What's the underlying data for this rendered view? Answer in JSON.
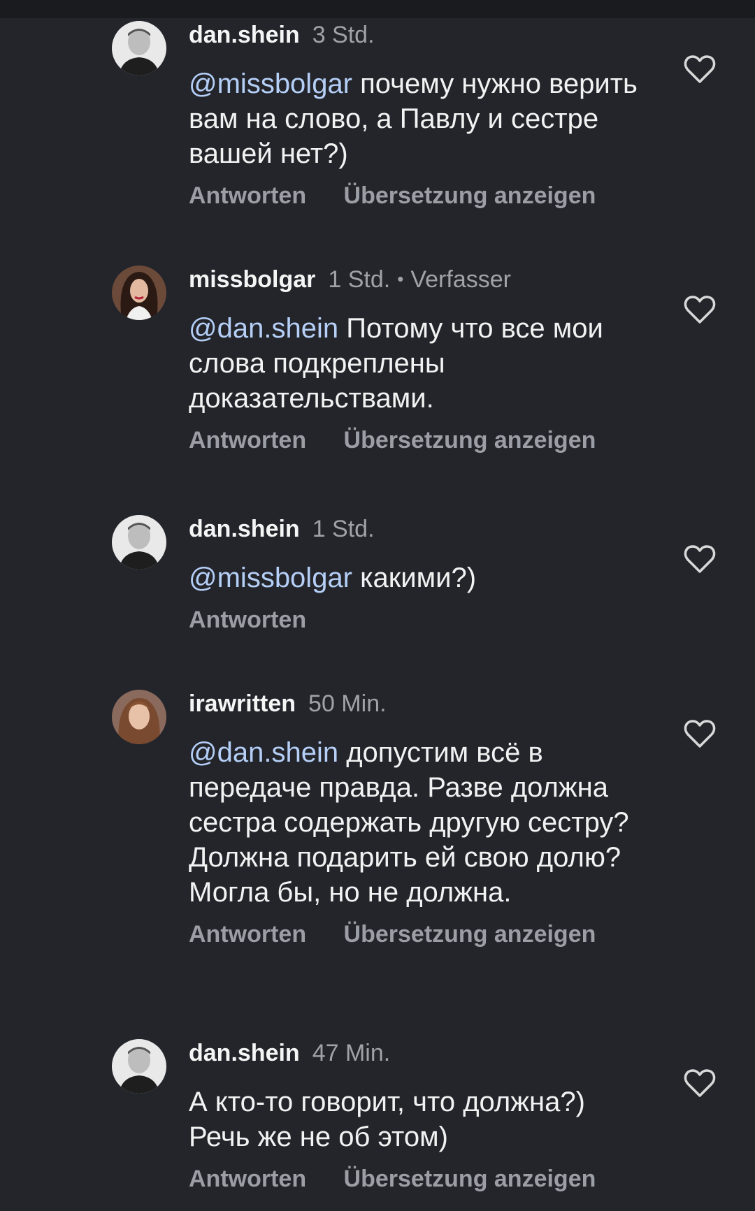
{
  "actions": {
    "reply": "Antworten",
    "translate": "Übersetzung anzeigen"
  },
  "icons": {
    "like": "heart-outline-icon"
  },
  "colors": {
    "background": "#23252b",
    "mention": "#b5cff7",
    "secondary_text": "#a0a2a8"
  },
  "comments": [
    {
      "username": "dan.shein",
      "time": "3 Std.",
      "mention": "@missbolgar",
      "text_line1": " почему нужно",
      "text_rest": "верить вам на слово, а Павлу и сестре вашей нет?)"
    },
    {
      "username": "missbolgar",
      "time": "1 Std.",
      "author_dot": "•",
      "author_tag": "Verfasser",
      "mention": "@dan.shein",
      "text_line1": " Потому что все мои",
      "text_rest": "слова подкреплены доказательствами."
    },
    {
      "username": "dan.shein",
      "time": "1 Std.",
      "mention": "@missbolgar",
      "text_line1": " какими?)"
    },
    {
      "username": "irawritten",
      "time": "50 Min.",
      "mention": "@dan.shein",
      "text_line1": " допустим всё в",
      "text_rest": "передаче правда. Разве должна сестра содержать другую сестру? Должна подарить ей свою долю? Могла бы, но не должна."
    },
    {
      "username": "dan.shein",
      "time": "47 Min.",
      "text_line1": "А кто-то говорит, что должна?)",
      "text_rest": "Речь же не об этом)"
    }
  ]
}
